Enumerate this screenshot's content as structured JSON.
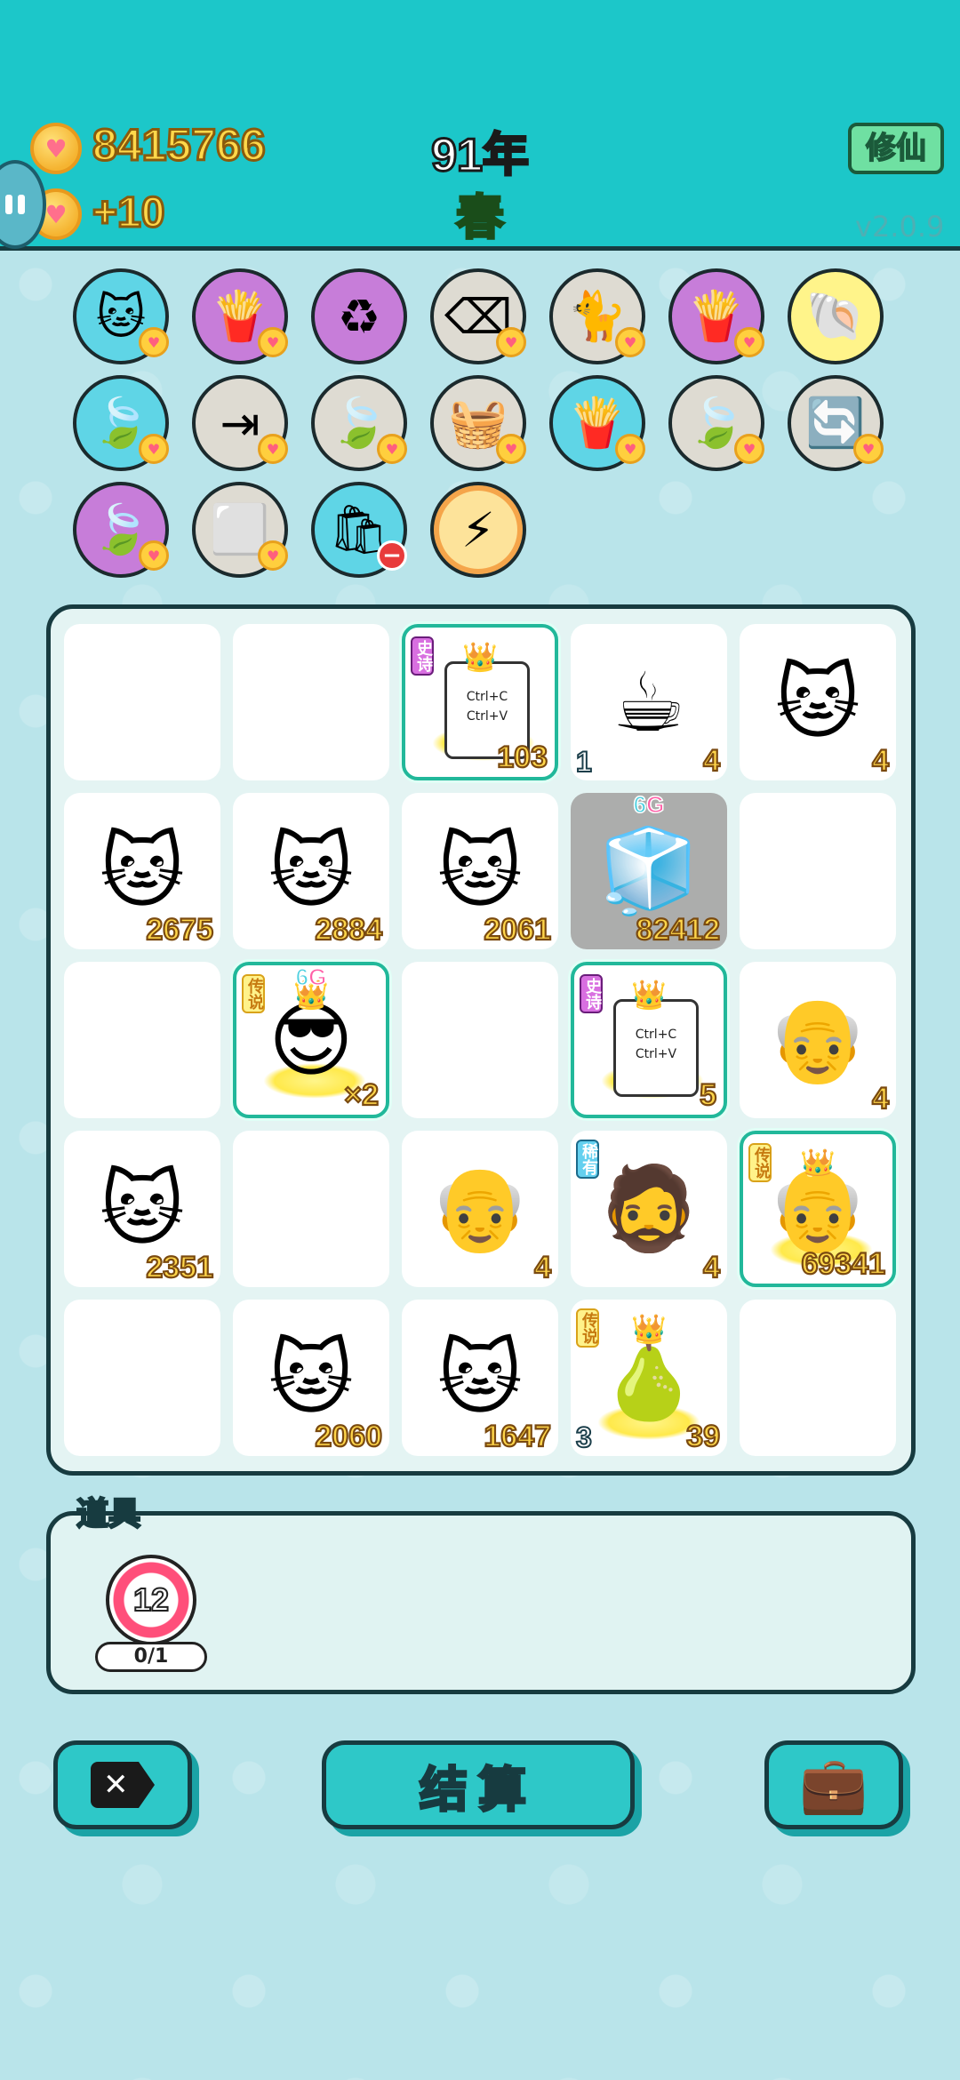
{
  "header": {
    "coin_total": "8415766",
    "coin_income": "+10",
    "year": "91年",
    "season": "春",
    "xiuxian_label": "修仙",
    "version": "v2.0.9"
  },
  "skills": [
    {
      "icon": "cat-icon",
      "glyph": "🐱",
      "bg": "cyan",
      "badge": "heart"
    },
    {
      "icon": "fries-icon",
      "glyph": "🍟",
      "bg": "purple",
      "badge": "heart"
    },
    {
      "icon": "recycle-icon",
      "glyph": "♻",
      "bg": "purple",
      "badge": ""
    },
    {
      "icon": "delete-tag-icon",
      "glyph": "⌫",
      "bg": "grey",
      "badge": "heart"
    },
    {
      "icon": "cat-pair-icon",
      "glyph": "🐈",
      "bg": "grey",
      "badge": "heart"
    },
    {
      "icon": "fries-icon",
      "glyph": "🍟",
      "bg": "purple",
      "badge": "heart"
    },
    {
      "icon": "shell-icon",
      "glyph": "🐚",
      "bg": "yellow",
      "badge": ""
    },
    {
      "icon": "leaf-icon",
      "glyph": "🍃",
      "bg": "cyan",
      "badge": "heart"
    },
    {
      "icon": "skip-icon",
      "glyph": "⇥",
      "bg": "grey",
      "badge": "heart"
    },
    {
      "icon": "leaf-icon",
      "glyph": "🍃",
      "bg": "grey",
      "badge": "heart"
    },
    {
      "icon": "fruit-basket-icon",
      "glyph": "🧺",
      "bg": "grey",
      "badge": "heart"
    },
    {
      "icon": "fries-icon",
      "glyph": "🍟",
      "bg": "cyan",
      "badge": "heart"
    },
    {
      "icon": "leaf-icon",
      "glyph": "🍃",
      "bg": "grey",
      "badge": "heart"
    },
    {
      "icon": "refresh-icon",
      "glyph": "🔄",
      "bg": "grey",
      "badge": "heart"
    },
    {
      "icon": "leaf-icon",
      "glyph": "🍃",
      "bg": "purple",
      "badge": "heart"
    },
    {
      "icon": "sugar-cubes-icon",
      "glyph": "⬜",
      "bg": "grey",
      "badge": "heart"
    },
    {
      "icon": "trash-bag-icon",
      "glyph": "🛍",
      "bg": "cyan",
      "badge": "minus"
    },
    {
      "icon": "lightning-icon",
      "glyph": "⚡",
      "bg": "orange",
      "badge": ""
    }
  ],
  "board": [
    [
      {
        "type": "empty"
      },
      {
        "type": "empty"
      },
      {
        "type": "card",
        "tag": "史诗",
        "tagClass": "epic",
        "line1": "Ctrl+C",
        "line2": "Ctrl+V",
        "crown": true,
        "glow": true,
        "num": "103",
        "lnum": "",
        "framed": true
      },
      {
        "type": "pic",
        "icon": "coffee-icon",
        "glyph": "☕",
        "num": "4",
        "lnum": "1"
      },
      {
        "type": "pic",
        "icon": "cat-icon",
        "glyph": "🐱",
        "num": "4"
      }
    ],
    [
      {
        "type": "pic",
        "icon": "cat-icon",
        "glyph": "🐱",
        "num": "2675"
      },
      {
        "type": "pic",
        "icon": "cat-icon",
        "glyph": "🐱",
        "num": "2884"
      },
      {
        "type": "pic",
        "icon": "cat-icon",
        "glyph": "🐱",
        "num": "2061"
      },
      {
        "type": "pic",
        "icon": "fridge-icon",
        "glyph": "🧊",
        "num": "82412",
        "gray": true,
        "sixg": [
          "6",
          "G"
        ]
      },
      {
        "type": "empty"
      }
    ],
    [
      {
        "type": "empty"
      },
      {
        "type": "pic",
        "icon": "sunglasses-man-icon",
        "glyph": "😎",
        "num": "×2",
        "tag": "传说",
        "tagClass": "legend",
        "framed": true,
        "crown": true,
        "glow": true,
        "sixg": [
          "6",
          "G"
        ]
      },
      {
        "type": "empty"
      },
      {
        "type": "card",
        "tag": "史诗",
        "tagClass": "epic",
        "line1": "Ctrl+C",
        "line2": "Ctrl+V",
        "crown": true,
        "glow": true,
        "num": "5",
        "framed": true
      },
      {
        "type": "pic",
        "icon": "old-man-icon",
        "glyph": "👴",
        "num": "4"
      }
    ],
    [
      {
        "type": "pic",
        "icon": "cat-icon",
        "glyph": "🐱",
        "num": "2351"
      },
      {
        "type": "empty"
      },
      {
        "type": "pic",
        "icon": "old-man-icon",
        "glyph": "👴",
        "num": "4"
      },
      {
        "type": "pic",
        "icon": "bucket-hat-man-icon",
        "glyph": "🧔",
        "num": "4",
        "tag": "稀有",
        "tagClass": "rare"
      },
      {
        "type": "pic",
        "icon": "crowned-old-man-icon",
        "glyph": "👴",
        "num": "69341",
        "tag": "传说",
        "tagClass": "legend",
        "framed": true,
        "crown": true,
        "glow": true
      }
    ],
    [
      {
        "type": "empty"
      },
      {
        "type": "pic",
        "icon": "cat-icon",
        "glyph": "🐱",
        "num": "2060"
      },
      {
        "type": "pic",
        "icon": "cat-icon",
        "glyph": "🐱",
        "num": "1647"
      },
      {
        "type": "pic",
        "icon": "crowned-pear-icon",
        "glyph": "🍐",
        "num": "39",
        "lnum": "3",
        "tag": "传说",
        "tagClass": "legend",
        "crown": true,
        "glow": true
      },
      {
        "type": "empty"
      }
    ]
  ],
  "items": {
    "title": "道具",
    "target_value": "12",
    "target_count": "0/1"
  },
  "buttons": {
    "delete_glyph": "✕",
    "settle_label": "结算",
    "bag_glyph": "💼"
  }
}
